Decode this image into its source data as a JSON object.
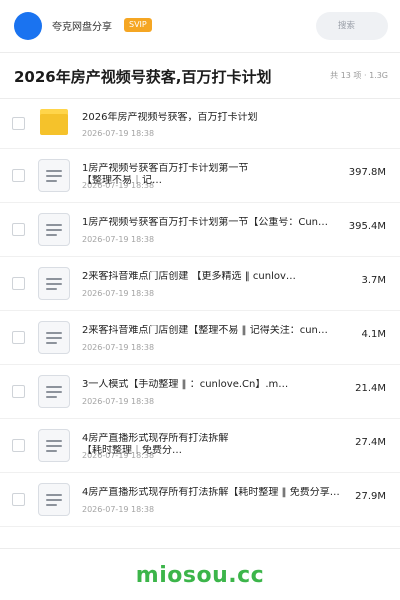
{
  "header": {
    "username": "夸克网盘分享",
    "badge": "SVIP",
    "search_placeholder": "搜索",
    "accent_color": "#1a73f0"
  },
  "share": {
    "title": "2026年房产视频号获客,百万打卡计划",
    "meta": "共 13 项 · 1.3G"
  },
  "items": [
    {
      "type": "folder",
      "icon": "folder-icon",
      "name": "2026年房产视频号获客，百万打卡计划",
      "name_line2": "",
      "date": "2026-07-19 18:38",
      "size": ""
    },
    {
      "type": "file",
      "icon": "document-icon",
      "name": "1房产视频号获客百万打卡计划第一节",
      "name_line2": "【整理不易｜记…",
      "date": "2026-07-19 18:38",
      "size": "397.8M"
    },
    {
      "type": "file",
      "icon": "document-icon",
      "name": "1房产视频号获客百万打卡计划第一节【公重号：Cun…",
      "name_line2": "",
      "date": "2026-07-19 18:38",
      "size": "395.4M"
    },
    {
      "type": "file",
      "icon": "document-icon",
      "name": "2来客抖音难点门店创建 【更多精选 ‖ cunlov…",
      "name_line2": "",
      "date": "2026-07-19 18:38",
      "size": "3.7M"
    },
    {
      "type": "file",
      "icon": "document-icon",
      "name": "2来客抖音难点门店创建【整理不易 ‖ 记得关注：cun…",
      "name_line2": "",
      "date": "2026-07-19 18:38",
      "size": "4.1M"
    },
    {
      "type": "file",
      "icon": "document-icon",
      "name": "3一人模式【手动整理 ‖ ：cunlove.Cn】.m…",
      "name_line2": "",
      "date": "2026-07-19 18:38",
      "size": "21.4M"
    },
    {
      "type": "file",
      "icon": "document-icon",
      "name": "4房产直播形式现存所有打法拆解",
      "name_line2": "【耗时整理｜免费分…",
      "date": "2026-07-19 18:38",
      "size": "27.4M"
    },
    {
      "type": "file",
      "icon": "document-icon",
      "name": "4房产直播形式现存所有打法拆解【耗时整理 ‖ 免费分享…",
      "name_line2": "",
      "date": "2026-07-19 18:38",
      "size": "27.9M"
    }
  ],
  "footer": {
    "watermark": "miosou.cc",
    "watermark_color": "#3cb54a"
  }
}
